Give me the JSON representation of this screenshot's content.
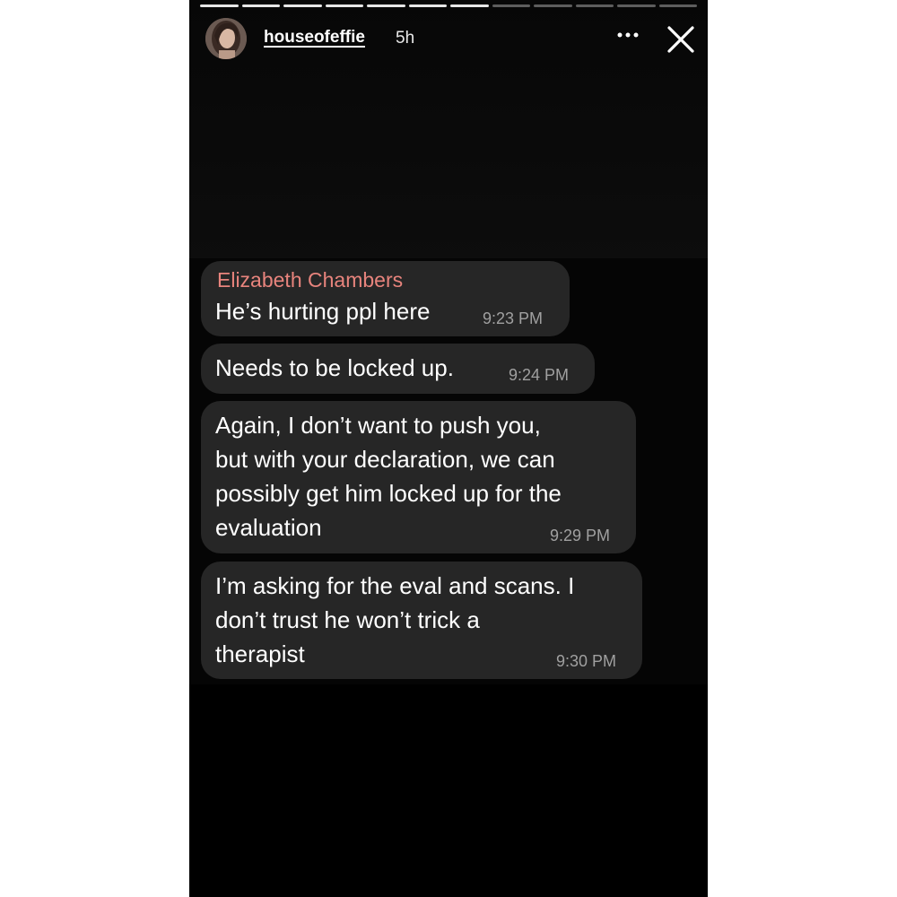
{
  "story": {
    "progress_segments": 12,
    "progress_completed": 7,
    "username": "houseofeffie",
    "age": "5h",
    "more_icon": "ellipsis-icon",
    "close_icon": "close-icon",
    "colors": {
      "background": "#000000",
      "bubble": "#262626",
      "sender": "#e8847d",
      "time": "#a0a0a0"
    }
  },
  "messages": [
    {
      "sender": "Elizabeth Chambers",
      "lines": [
        "He’s hurting ppl here"
      ],
      "time": "9:23 PM"
    },
    {
      "lines": [
        "Needs to be locked up."
      ],
      "time": "9:24 PM"
    },
    {
      "lines": [
        "Again, I don’t want to push you,",
        "but with your declaration, we can",
        "possibly get him locked up for the",
        "evaluation"
      ],
      "time": "9:29 PM"
    },
    {
      "lines": [
        "I’m asking for the eval and scans. I",
        "don’t trust he won’t trick a",
        "therapist"
      ],
      "time": "9:30 PM"
    }
  ]
}
